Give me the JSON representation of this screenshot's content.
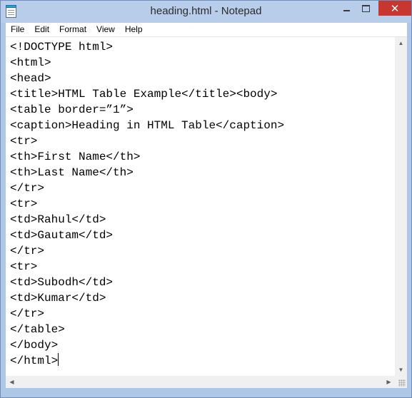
{
  "window": {
    "title": "heading.html - Notepad",
    "close_glyph": "✕",
    "accent_color": "#c7372f",
    "frame_color": "#aec7e6"
  },
  "menu": {
    "items": [
      {
        "label": "File"
      },
      {
        "label": "Edit"
      },
      {
        "label": "Format"
      },
      {
        "label": "View"
      },
      {
        "label": "Help"
      }
    ]
  },
  "editor": {
    "lines": [
      "<!DOCTYPE html>",
      "<html>",
      "<head>",
      "<title>HTML Table Example</title><body>",
      "<table border=”1”>",
      "<caption>Heading in HTML Table</caption>",
      "<tr>",
      "<th>First Name</th>",
      "<th>Last Name</th>",
      "</tr>",
      "<tr>",
      "<td>Rahul</td>",
      "<td>Gautam</td>",
      "</tr>",
      "<tr>",
      "<td>Subodh</td>",
      "<td>Kumar</td>",
      "</tr>",
      "</table>",
      "</body>",
      "</html>"
    ]
  },
  "scrollbars": {
    "up_arrow": "▲",
    "down_arrow": "▼",
    "left_arrow": "◀",
    "right_arrow": "▶"
  }
}
